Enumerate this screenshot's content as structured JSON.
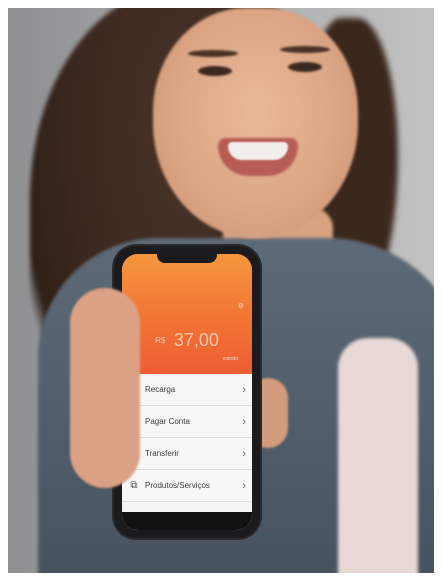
{
  "app": {
    "balance": {
      "currency": "R$",
      "amount": "37,00"
    },
    "hero_link": "extrato",
    "menu": [
      {
        "icon": "recharge-icon",
        "label": "Recarga",
        "glyph": "▤"
      },
      {
        "icon": "barcode-icon",
        "label": "Pagar Conta",
        "glyph": "|||"
      },
      {
        "icon": "transfer-icon",
        "label": "Transferir",
        "glyph": "⇄"
      },
      {
        "icon": "products-icon",
        "label": "Produtos/Serviços",
        "glyph": "⧉"
      }
    ],
    "chevron": "›"
  },
  "colors": {
    "accent_top": "#f6963e",
    "accent_bottom": "#ee5c33"
  }
}
